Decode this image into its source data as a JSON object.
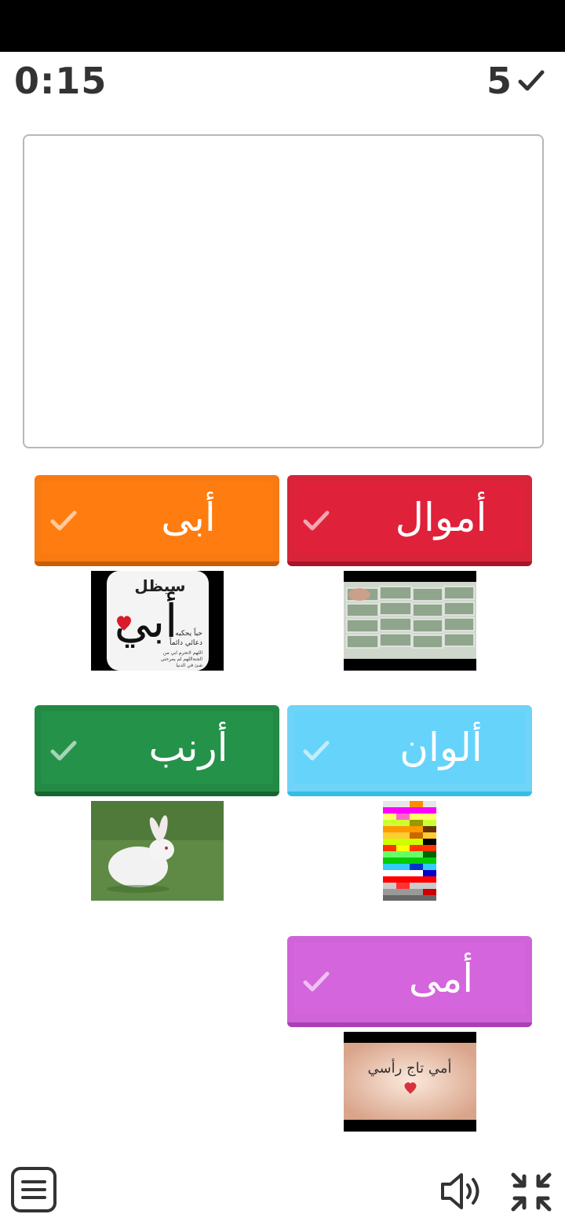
{
  "header": {
    "timer": "0:15",
    "score": "5"
  },
  "options": [
    {
      "id": "abi",
      "label": "أبى",
      "color": "#ff7d10",
      "image": "abi-image"
    },
    {
      "id": "amwal",
      "label": "أموال",
      "color": "#e0213a",
      "image": "money-image"
    },
    {
      "id": "arnab",
      "label": "أرنب",
      "color": "#25924a",
      "image": "rabbit-image"
    },
    {
      "id": "alwan",
      "label": "ألوان",
      "color": "#66d3fb",
      "image": "colors-image"
    },
    {
      "id": "umi",
      "label": "أمى",
      "color": "#d465dc",
      "image": "mom-image"
    }
  ],
  "images": {
    "abi_image": {
      "title": "سيظل",
      "big": "أبي",
      "lines": [
        "حباً يحكيه",
        "دعائي دائماً",
        "اللهم لاتحرم ابي من",
        "الجنةاللهم لم يمرحني",
        "شئ في الدنيا"
      ]
    },
    "mom_image": {
      "text": "أمي تاج رأسي"
    }
  },
  "footer": {
    "menu_icon": "menu-icon",
    "sound_icon": "speaker-icon",
    "shrink_icon": "collapse-icon"
  }
}
